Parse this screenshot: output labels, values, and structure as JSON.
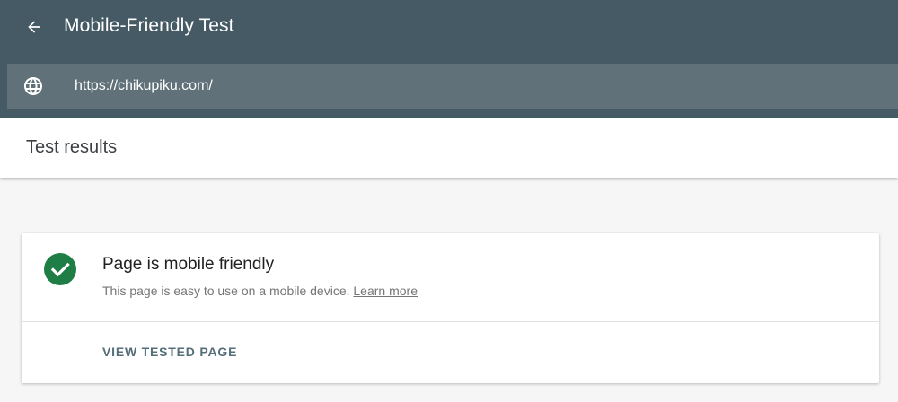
{
  "header": {
    "back_icon": "arrow-back-icon",
    "title": "Mobile-Friendly Test",
    "bg_color": "#455a64"
  },
  "url_bar": {
    "icon": "globe-icon",
    "value": "https://chikupiku.com/",
    "bg_color": "#607179"
  },
  "results": {
    "title": "Test results"
  },
  "result_card": {
    "status_icon": "check-circle-icon",
    "status_color": "#1e7e45",
    "title": "Page is mobile friendly",
    "description": "This page is easy to use on a mobile device.",
    "learn_more": "Learn more",
    "action_label": "VIEW TESTED PAGE"
  }
}
